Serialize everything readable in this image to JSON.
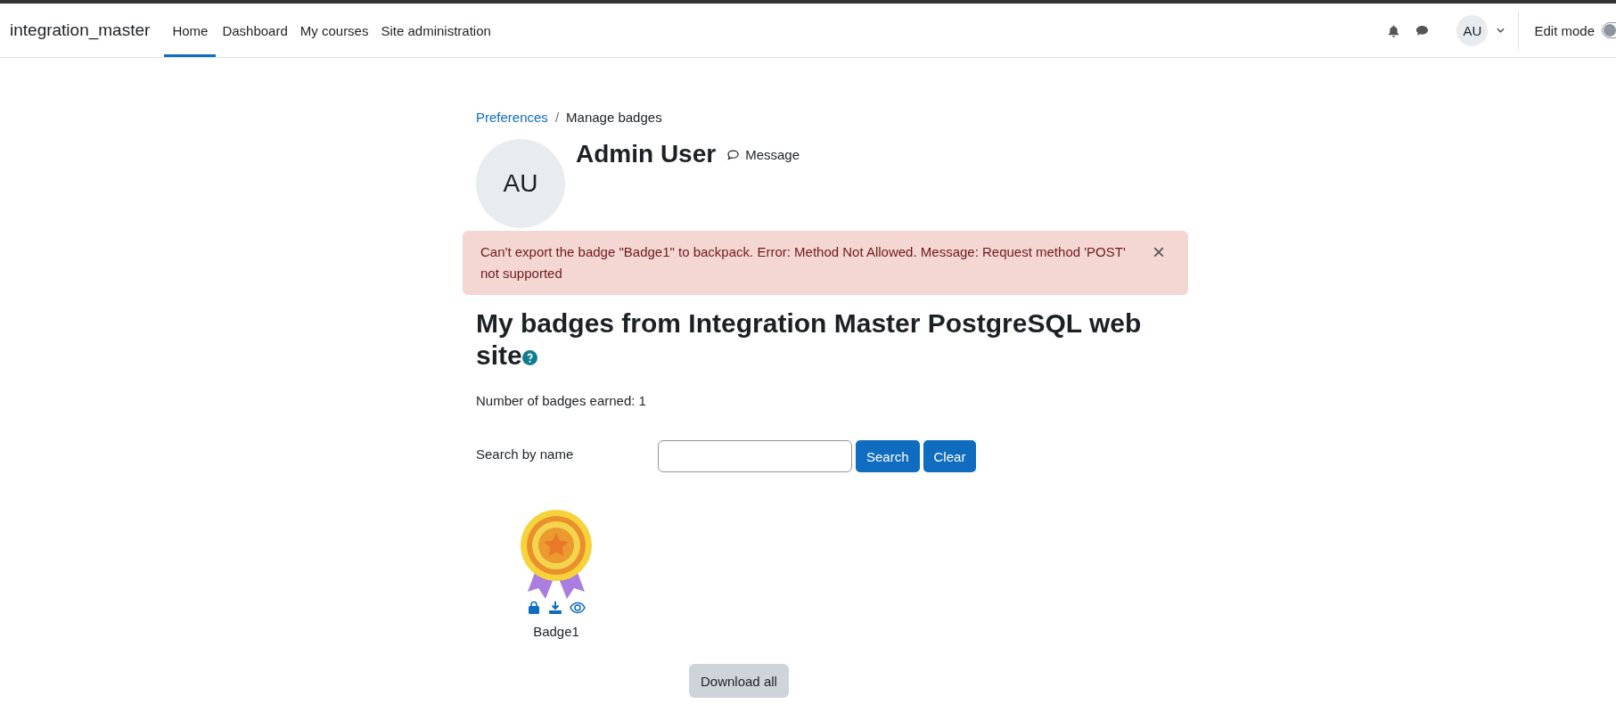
{
  "navbar": {
    "brand": "integration_master",
    "items": [
      {
        "label": "Home",
        "selected": true
      },
      {
        "label": "Dashboard",
        "selected": false
      },
      {
        "label": "My courses",
        "selected": false
      },
      {
        "label": "Site administration",
        "selected": false
      }
    ],
    "user_initials": "AU",
    "edit_mode": {
      "label": "Edit mode",
      "on": false
    }
  },
  "breadcrumb": {
    "separator": "/",
    "items": [
      {
        "label": "Preferences",
        "kind": "link"
      },
      {
        "label": "Manage badges",
        "kind": "current"
      }
    ]
  },
  "profile": {
    "initials": "AU",
    "name": "Admin User",
    "message_label": "Message"
  },
  "alert": {
    "text": "Can't export the badge \"Badge1\" to backpack. Error: Method Not Allowed. Message: Request method 'POST' not supported",
    "close": "×"
  },
  "heading": "My badges from Integration Master PostgreSQL web site",
  "badges_earned": "Number of badges earned: 1",
  "search": {
    "label": "Search by name",
    "buttons": [
      "Search",
      "Clear"
    ]
  },
  "badges": [
    {
      "name": "Badge1"
    }
  ],
  "download_all": "Download all"
}
